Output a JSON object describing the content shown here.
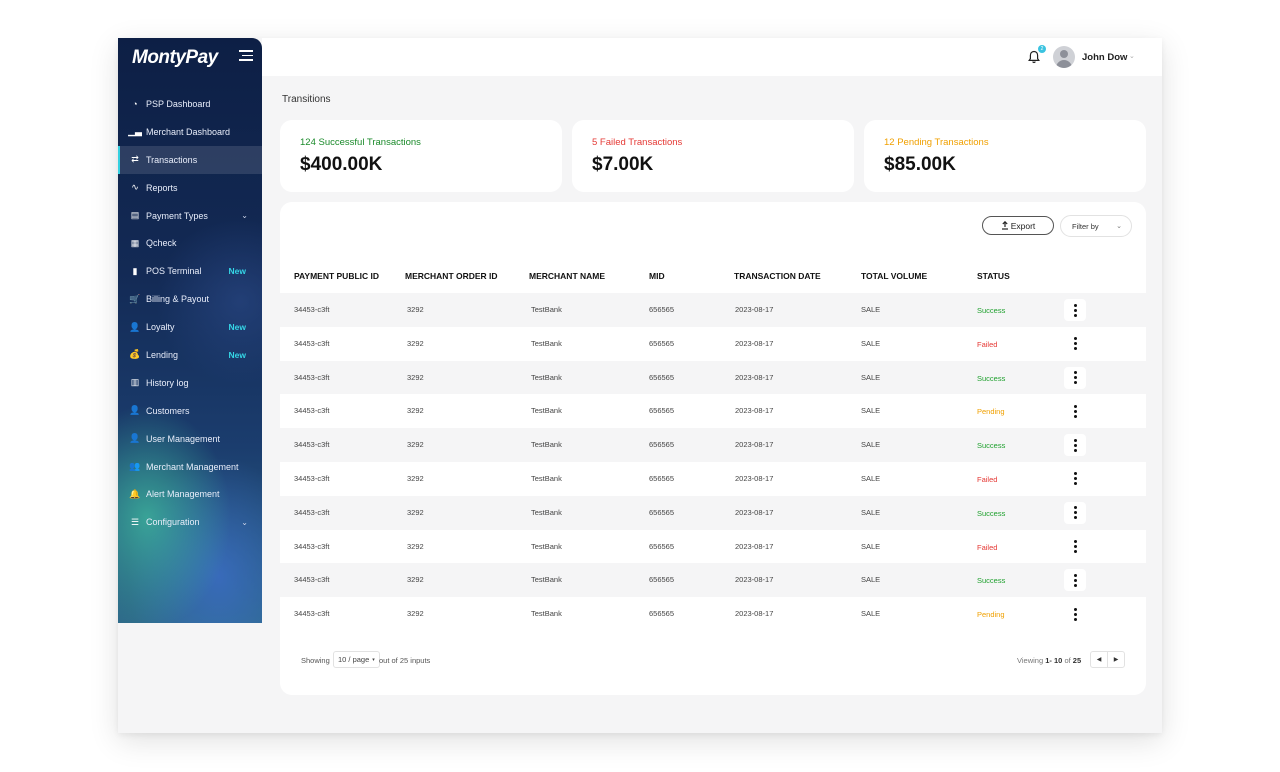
{
  "app": {
    "brand": "MontyPay"
  },
  "sidebar": {
    "items": [
      {
        "label": "PSP Dashboard",
        "icon": "pie-chart-icon",
        "glyph": "◔",
        "badge": "",
        "chevron": false,
        "active": false
      },
      {
        "label": "Merchant Dashboard",
        "icon": "bar-chart-icon",
        "glyph": "▁▃",
        "badge": "",
        "chevron": false,
        "active": false
      },
      {
        "label": "Transactions",
        "icon": "transfer-arrows-icon",
        "glyph": "⇄",
        "badge": "",
        "chevron": false,
        "active": true
      },
      {
        "label": "Reports",
        "icon": "line-chart-icon",
        "glyph": "∿",
        "badge": "",
        "chevron": false,
        "active": false
      },
      {
        "label": "Payment Types",
        "icon": "document-icon",
        "glyph": "▤",
        "badge": "",
        "chevron": true,
        "active": false
      },
      {
        "label": "Qcheck",
        "icon": "qr-code-icon",
        "glyph": "▦",
        "badge": "",
        "chevron": false,
        "active": false
      },
      {
        "label": "POS Terminal",
        "icon": "pos-terminal-icon",
        "glyph": "▮",
        "badge": "New",
        "chevron": false,
        "active": false
      },
      {
        "label": "Billing & Payout",
        "icon": "cart-icon",
        "glyph": "🛒",
        "badge": "",
        "chevron": false,
        "active": false
      },
      {
        "label": "Loyalty",
        "icon": "user-plus-icon",
        "glyph": "👤",
        "badge": "New",
        "chevron": false,
        "active": false
      },
      {
        "label": "Lending",
        "icon": "money-bag-icon",
        "glyph": "💰",
        "badge": "New",
        "chevron": false,
        "active": false
      },
      {
        "label": "History log",
        "icon": "history-icon",
        "glyph": "▥",
        "badge": "",
        "chevron": false,
        "active": false
      },
      {
        "label": "Customers",
        "icon": "user-icon",
        "glyph": "👤",
        "badge": "",
        "chevron": false,
        "active": false
      },
      {
        "label": "User Management",
        "icon": "user-gear-icon",
        "glyph": "👤",
        "badge": "",
        "chevron": false,
        "active": false
      },
      {
        "label": "Merchant Management",
        "icon": "users-icon",
        "glyph": "👥",
        "badge": "",
        "chevron": false,
        "active": false
      },
      {
        "label": "Alert Management",
        "icon": "bell-icon",
        "glyph": "🔔",
        "badge": "",
        "chevron": false,
        "active": false
      },
      {
        "label": "Configuration",
        "icon": "sliders-icon",
        "glyph": "☰",
        "badge": "",
        "chevron": true,
        "active": false
      }
    ]
  },
  "header": {
    "notification_count": "2",
    "user_name": "John Dow"
  },
  "page": {
    "title": "Transitions"
  },
  "summary_cards": [
    {
      "label": "124 Successful Transactions",
      "value": "$400.00K",
      "color": "#1a8a2a"
    },
    {
      "label": "5 Failed Transactions",
      "value": "$7.00K",
      "color": "#e53935"
    },
    {
      "label": "12 Pending Transactions",
      "value": "$85.00K",
      "color": "#f0a000"
    }
  ],
  "toolbar": {
    "export_label": "Export",
    "filter_label": "Filter by"
  },
  "table": {
    "columns": [
      "PAYMENT PUBLIC ID",
      "MERCHANT ORDER ID",
      "MERCHANT NAME",
      "MID",
      "TRANSACTION DATE",
      "TOTAL VOLUME",
      "STATUS"
    ],
    "rows": [
      {
        "payment_id": "34453-c3ft",
        "order_id": "3292",
        "merchant": "TestBank",
        "mid": "656565",
        "date": "2023-08-17",
        "volume": "SALE",
        "status": "Success"
      },
      {
        "payment_id": "34453-c3ft",
        "order_id": "3292",
        "merchant": "TestBank",
        "mid": "656565",
        "date": "2023-08-17",
        "volume": "SALE",
        "status": "Failed"
      },
      {
        "payment_id": "34453-c3ft",
        "order_id": "3292",
        "merchant": "TestBank",
        "mid": "656565",
        "date": "2023-08-17",
        "volume": "SALE",
        "status": "Success"
      },
      {
        "payment_id": "34453-c3ft",
        "order_id": "3292",
        "merchant": "TestBank",
        "mid": "656565",
        "date": "2023-08-17",
        "volume": "SALE",
        "status": "Pending"
      },
      {
        "payment_id": "34453-c3ft",
        "order_id": "3292",
        "merchant": "TestBank",
        "mid": "656565",
        "date": "2023-08-17",
        "volume": "SALE",
        "status": "Success"
      },
      {
        "payment_id": "34453-c3ft",
        "order_id": "3292",
        "merchant": "TestBank",
        "mid": "656565",
        "date": "2023-08-17",
        "volume": "SALE",
        "status": "Failed"
      },
      {
        "payment_id": "34453-c3ft",
        "order_id": "3292",
        "merchant": "TestBank",
        "mid": "656565",
        "date": "2023-08-17",
        "volume": "SALE",
        "status": "Success"
      },
      {
        "payment_id": "34453-c3ft",
        "order_id": "3292",
        "merchant": "TestBank",
        "mid": "656565",
        "date": "2023-08-17",
        "volume": "SALE",
        "status": "Failed"
      },
      {
        "payment_id": "34453-c3ft",
        "order_id": "3292",
        "merchant": "TestBank",
        "mid": "656565",
        "date": "2023-08-17",
        "volume": "SALE",
        "status": "Success"
      },
      {
        "payment_id": "34453-c3ft",
        "order_id": "3292",
        "merchant": "TestBank",
        "mid": "656565",
        "date": "2023-08-17",
        "volume": "SALE",
        "status": "Pending"
      }
    ],
    "status_colors": {
      "Success": "#1fa02e",
      "Failed": "#e53935",
      "Pending": "#f0a000"
    }
  },
  "pagination": {
    "showing_label": "Showing",
    "page_size": "10 / page",
    "out_of": "out of 25 inputs",
    "viewing_label": "Viewing",
    "range": "1- 10",
    "of_label": "of",
    "total": "25"
  }
}
